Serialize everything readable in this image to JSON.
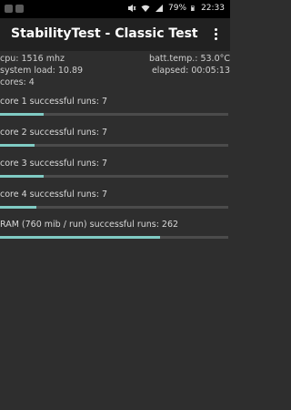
{
  "status_bar": {
    "battery": "79%",
    "time": "22:33"
  },
  "app": {
    "title": "StabilityTest - Classic Test"
  },
  "stats": {
    "cpu": "cpu: 1516 mhz",
    "batt_temp": "batt.temp.: 53.0°C",
    "system_load": "system load: 10.89",
    "elapsed": "elapsed: 00:05:13",
    "cores": "cores: 4"
  },
  "runs": [
    {
      "label": "core 1 successful runs: 7",
      "progress": 0.19
    },
    {
      "label": "core 2 successful runs: 7",
      "progress": 0.15
    },
    {
      "label": "core 3 successful runs: 7",
      "progress": 0.19
    },
    {
      "label": "core 4 successful runs: 7",
      "progress": 0.16
    },
    {
      "label": "RAM (760 mib / run) successful runs: 262",
      "progress": 0.7
    }
  ],
  "colors": {
    "progress_fill": "#80cbc4",
    "progress_track": "#4b4b4b",
    "background": "#2e2e2e",
    "appbar": "#212121"
  }
}
